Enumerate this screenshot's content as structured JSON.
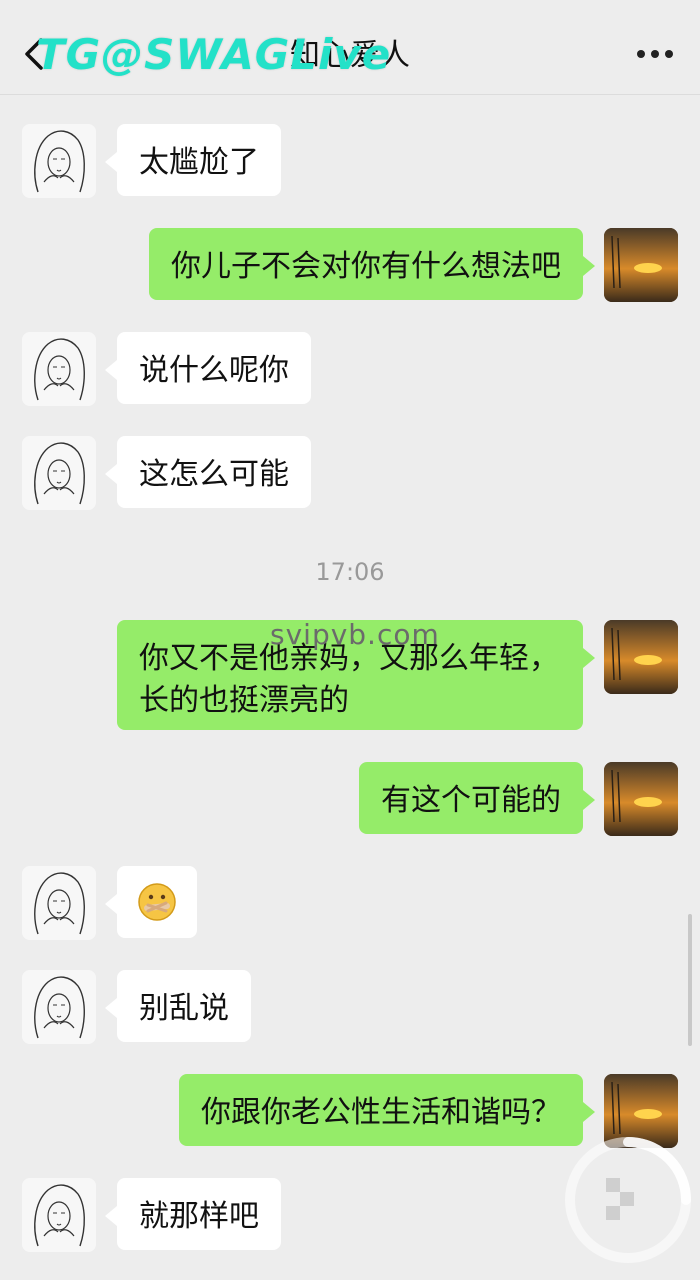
{
  "header": {
    "title": "知心爱人",
    "back_icon": "chevron-left-icon",
    "more_icon": "more-dots-icon"
  },
  "watermarks": {
    "top": "TG@SWAGLive",
    "middle": "svipvb.com"
  },
  "timestamp": "17:06",
  "messages": [
    {
      "side": "left",
      "text": "太尴尬了"
    },
    {
      "side": "right",
      "text": "你儿子不会对你有什么想法吧"
    },
    {
      "side": "left",
      "text": "说什么呢你"
    },
    {
      "side": "left",
      "text": "这怎么可能"
    },
    {
      "side": "right",
      "text": "你又不是他亲妈，又那么年轻，长的也挺漂亮的"
    },
    {
      "side": "right",
      "text": "有这个可能的"
    },
    {
      "side": "left",
      "text": "🤐"
    },
    {
      "side": "left",
      "text": "别乱说"
    },
    {
      "side": "right",
      "text": "你跟你老公性生活和谐吗？"
    },
    {
      "side": "left",
      "text": "就那样吧"
    }
  ],
  "icons": {
    "left_avatar": "sketch-woman-avatar",
    "right_avatar": "sunset-avatar",
    "loading": "loading-spinner-icon"
  }
}
